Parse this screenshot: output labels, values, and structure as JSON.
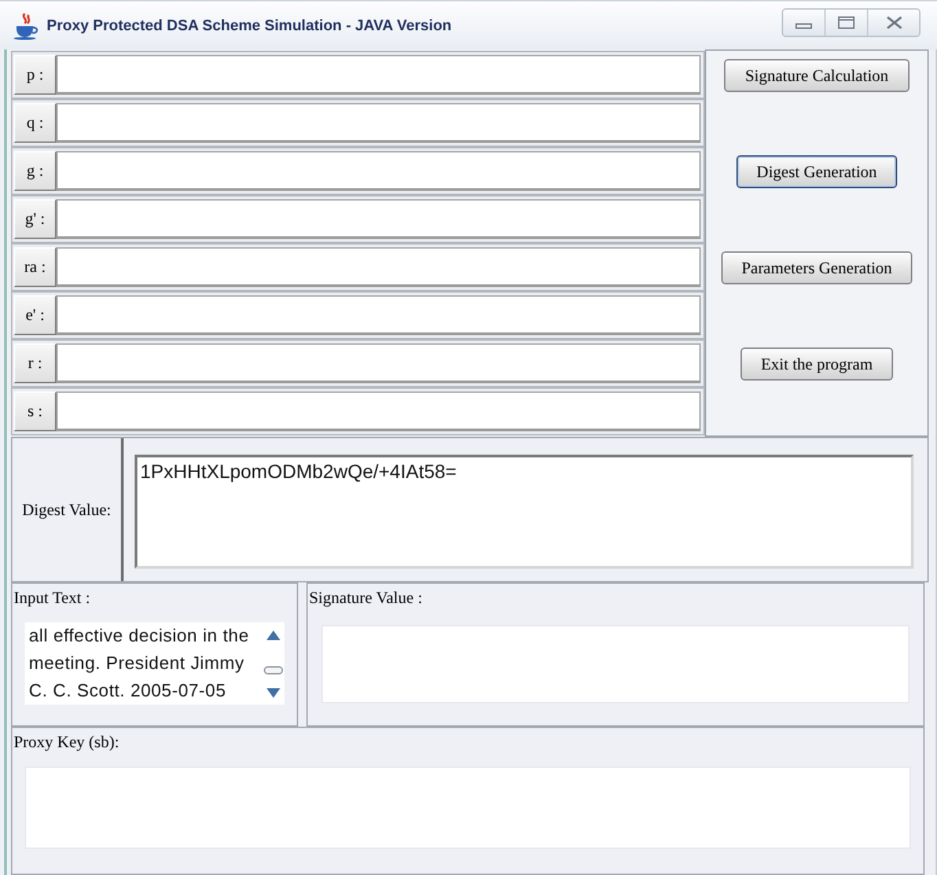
{
  "window": {
    "title": "Proxy Protected DSA Scheme Simulation - JAVA Version"
  },
  "parameters": [
    {
      "label": "p :"
    },
    {
      "label": "q :"
    },
    {
      "label": "g :"
    },
    {
      "label": "g' :"
    },
    {
      "label": "ra :"
    },
    {
      "label": "e' :"
    },
    {
      "label": "r :"
    },
    {
      "label": "s :"
    }
  ],
  "buttons": [
    {
      "label": "Signature Calculation",
      "focused": false
    },
    {
      "label": "Digest Generation",
      "focused": true
    },
    {
      "label": "Parameters Generation",
      "focused": false
    },
    {
      "label": "Exit the program",
      "focused": false
    }
  ],
  "digest": {
    "label": "Digest Value:",
    "value": "1PxHHtXLpomODMb2wQe/+4IAt58="
  },
  "input_text": {
    "label": "Input Text :",
    "value": "all effective decision in the meeting. President Jimmy C. C. Scott. 2005-07-05"
  },
  "signature": {
    "label": "Signature Value :"
  },
  "proxy_key": {
    "label": "Proxy Key (sb):"
  }
}
